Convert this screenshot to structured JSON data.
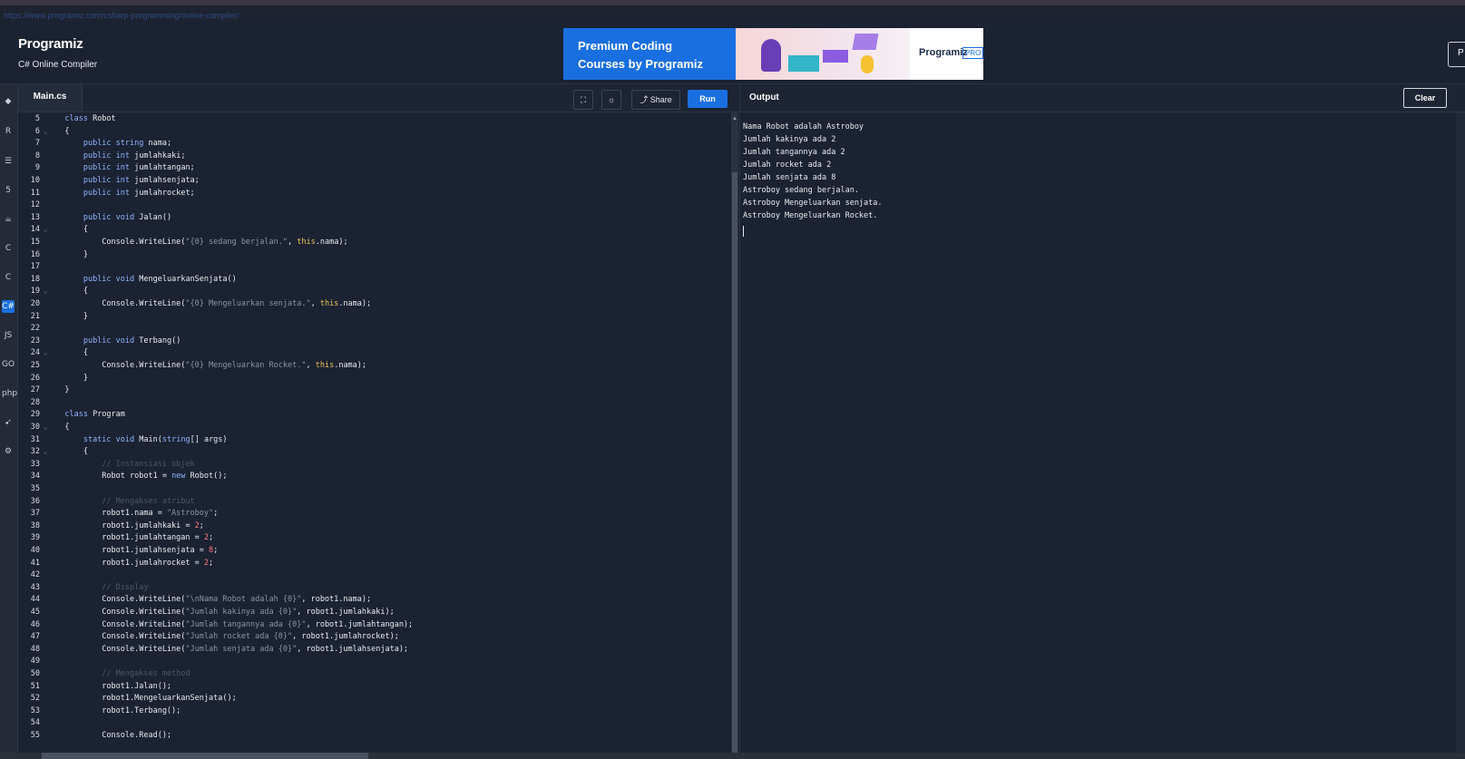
{
  "browser": {
    "faint_link": "https://www.programiz.com/csharp-programming/online-compiler/"
  },
  "header": {
    "logo": "Programiz",
    "subtitle": "C# Online Compiler",
    "ad_line1": "Premium Coding",
    "ad_line2": "Courses by Programiz",
    "ad_brand": "Programiz",
    "ad_badge": "PRO",
    "header_button": "P"
  },
  "sidebar": {
    "icons": [
      "python-icon",
      "r-icon",
      "sql-icon",
      "html-icon",
      "java-icon",
      "c-icon",
      "cpp-icon",
      "csharp-icon",
      "js-icon",
      "go-icon",
      "php-icon",
      "swift-icon",
      "rust-icon"
    ],
    "glyphs": [
      "◆",
      "R",
      "☰",
      "5",
      "☕",
      "C",
      "C",
      "C#",
      "JS",
      "GO",
      "php",
      "➹",
      "⚙"
    ]
  },
  "editor": {
    "tab": "Main.cs",
    "share_label": "Share",
    "run_label": "Run",
    "lines": [
      {
        "n": "5",
        "fold": "",
        "t": "class Robot"
      },
      {
        "n": "6",
        "fold": "⌄",
        "t": "{"
      },
      {
        "n": "7",
        "fold": "",
        "t": "    public string nama;"
      },
      {
        "n": "8",
        "fold": "",
        "t": "    public int jumlahkaki;"
      },
      {
        "n": "9",
        "fold": "",
        "t": "    public int jumlahtangan;"
      },
      {
        "n": "10",
        "fold": "",
        "t": "    public int jumlahsenjata;"
      },
      {
        "n": "11",
        "fold": "",
        "t": "    public int jumlahrocket;"
      },
      {
        "n": "12",
        "fold": "",
        "t": ""
      },
      {
        "n": "13",
        "fold": "",
        "t": "    public void Jalan()"
      },
      {
        "n": "14",
        "fold": "⌄",
        "t": "    {"
      },
      {
        "n": "15",
        "fold": "",
        "t": "        Console.WriteLine(\"{0} sedang berjalan.\", this.nama);"
      },
      {
        "n": "16",
        "fold": "",
        "t": "    }"
      },
      {
        "n": "17",
        "fold": "",
        "t": ""
      },
      {
        "n": "18",
        "fold": "",
        "t": "    public void MengeluarkanSenjata()"
      },
      {
        "n": "19",
        "fold": "⌄",
        "t": "    {"
      },
      {
        "n": "20",
        "fold": "",
        "t": "        Console.WriteLine(\"{0} Mengeluarkan senjata.\", this.nama);"
      },
      {
        "n": "21",
        "fold": "",
        "t": "    }"
      },
      {
        "n": "22",
        "fold": "",
        "t": ""
      },
      {
        "n": "23",
        "fold": "",
        "t": "    public void Terbang()"
      },
      {
        "n": "24",
        "fold": "⌄",
        "t": "    {"
      },
      {
        "n": "25",
        "fold": "",
        "t": "        Console.WriteLine(\"{0} Mengeluarkan Rocket.\", this.nama);"
      },
      {
        "n": "26",
        "fold": "",
        "t": "    }"
      },
      {
        "n": "27",
        "fold": "",
        "t": "}"
      },
      {
        "n": "28",
        "fold": "",
        "t": ""
      },
      {
        "n": "29",
        "fold": "",
        "t": "class Program"
      },
      {
        "n": "30",
        "fold": "⌄",
        "t": "{"
      },
      {
        "n": "31",
        "fold": "",
        "t": "    static void Main(string[] args)"
      },
      {
        "n": "32",
        "fold": "⌄",
        "t": "    {"
      },
      {
        "n": "33",
        "fold": "",
        "t": "        // Instansiasi objek"
      },
      {
        "n": "34",
        "fold": "",
        "t": "        Robot robot1 = new Robot();"
      },
      {
        "n": "35",
        "fold": "",
        "t": ""
      },
      {
        "n": "36",
        "fold": "",
        "t": "        // Mengakses atribut"
      },
      {
        "n": "37",
        "fold": "",
        "t": "        robot1.nama = \"Astroboy\";"
      },
      {
        "n": "38",
        "fold": "",
        "t": "        robot1.jumlahkaki = 2;"
      },
      {
        "n": "39",
        "fold": "",
        "t": "        robot1.jumlahtangan = 2;"
      },
      {
        "n": "40",
        "fold": "",
        "t": "        robot1.jumlahsenjata = 8;"
      },
      {
        "n": "41",
        "fold": "",
        "t": "        robot1.jumlahrocket = 2;"
      },
      {
        "n": "42",
        "fold": "",
        "t": ""
      },
      {
        "n": "43",
        "fold": "",
        "t": "        // Display"
      },
      {
        "n": "44",
        "fold": "",
        "t": "        Console.WriteLine(\"\\nNama Robot adalah {0}\", robot1.nama);"
      },
      {
        "n": "45",
        "fold": "",
        "t": "        Console.WriteLine(\"Jumlah kakinya ada {0}\", robot1.jumlahkaki);"
      },
      {
        "n": "46",
        "fold": "",
        "t": "        Console.WriteLine(\"Jumlah tangannya ada {0}\", robot1.jumlahtangan);"
      },
      {
        "n": "47",
        "fold": "",
        "t": "        Console.WriteLine(\"Jumlah rocket ada {0}\", robot1.jumlahrocket);"
      },
      {
        "n": "48",
        "fold": "",
        "t": "        Console.WriteLine(\"Jumlah senjata ada {0}\", robot1.jumlahsenjata);"
      },
      {
        "n": "49",
        "fold": "",
        "t": ""
      },
      {
        "n": "50",
        "fold": "",
        "t": "        // Mengakses method"
      },
      {
        "n": "51",
        "fold": "",
        "t": "        robot1.Jalan();"
      },
      {
        "n": "52",
        "fold": "",
        "t": "        robot1.MengeluarkanSenjata();"
      },
      {
        "n": "53",
        "fold": "",
        "t": "        robot1.Terbang();"
      },
      {
        "n": "54",
        "fold": "",
        "t": ""
      },
      {
        "n": "55",
        "fold": "",
        "t": "        Console.Read();"
      }
    ]
  },
  "output": {
    "title": "Output",
    "clear_label": "Clear",
    "lines": [
      "Nama Robot adalah Astroboy",
      "Jumlah kakinya ada 2",
      "Jumlah tangannya ada 2",
      "Jumlah rocket ada 2",
      "Jumlah senjata ada 8",
      "Astroboy sedang berjalan.",
      "Astroboy Mengeluarkan senjata.",
      "Astroboy Mengeluarkan Rocket."
    ]
  },
  "colors": {
    "accent": "#1a6fe0",
    "background": "#1b2232",
    "keyword": "#8fb4ff",
    "string": "#8c94a6",
    "comment": "#4d566a",
    "number": "#ff7a7a"
  }
}
